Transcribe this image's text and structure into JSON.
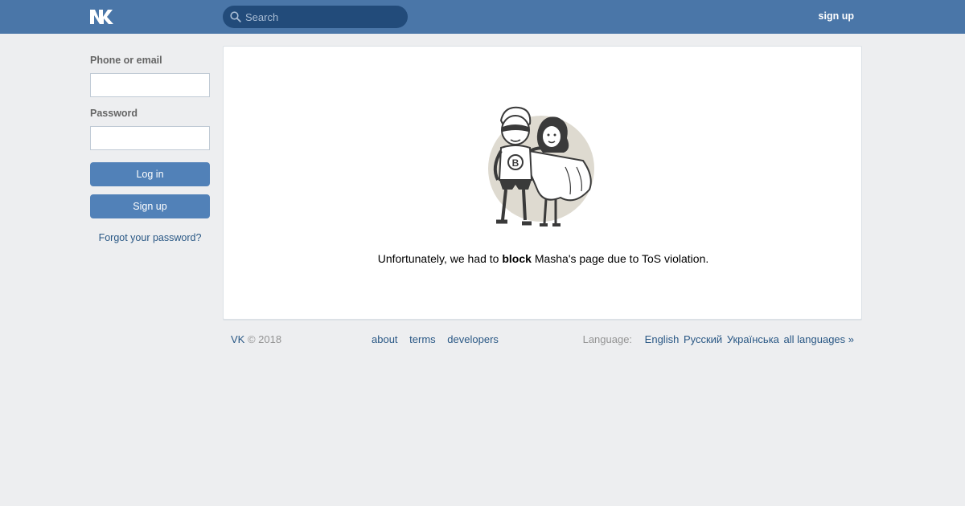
{
  "header": {
    "logo_icon": "vk-logo-icon",
    "search_icon": "search-icon",
    "search_placeholder": "Search",
    "signup_link": "sign up",
    "colors": {
      "bar": "#4a76a8",
      "search_bg": "#224b7a"
    }
  },
  "login": {
    "phone_label": "Phone or email",
    "phone_value": "",
    "password_label": "Password",
    "password_value": "",
    "login_button": "Log in",
    "signup_button": "Sign up",
    "forgot_link": "Forgot your password?",
    "colors": {
      "button": "#5181b8",
      "link": "#2a5885"
    }
  },
  "main": {
    "illustration_icon": "superhero-couple-illustration",
    "message_prefix": "Unfortunately, we had to",
    "message_bold": "block",
    "message_suffix": "Masha's page due to ToS violation."
  },
  "footer": {
    "brand": "VK",
    "copyright": "© 2018",
    "links": [
      "about",
      "terms",
      "developers"
    ],
    "language_label": "Language:",
    "languages": [
      "English",
      "Русский",
      "Українська",
      "all languages »"
    ]
  },
  "page": {
    "background": "#edeef0"
  }
}
